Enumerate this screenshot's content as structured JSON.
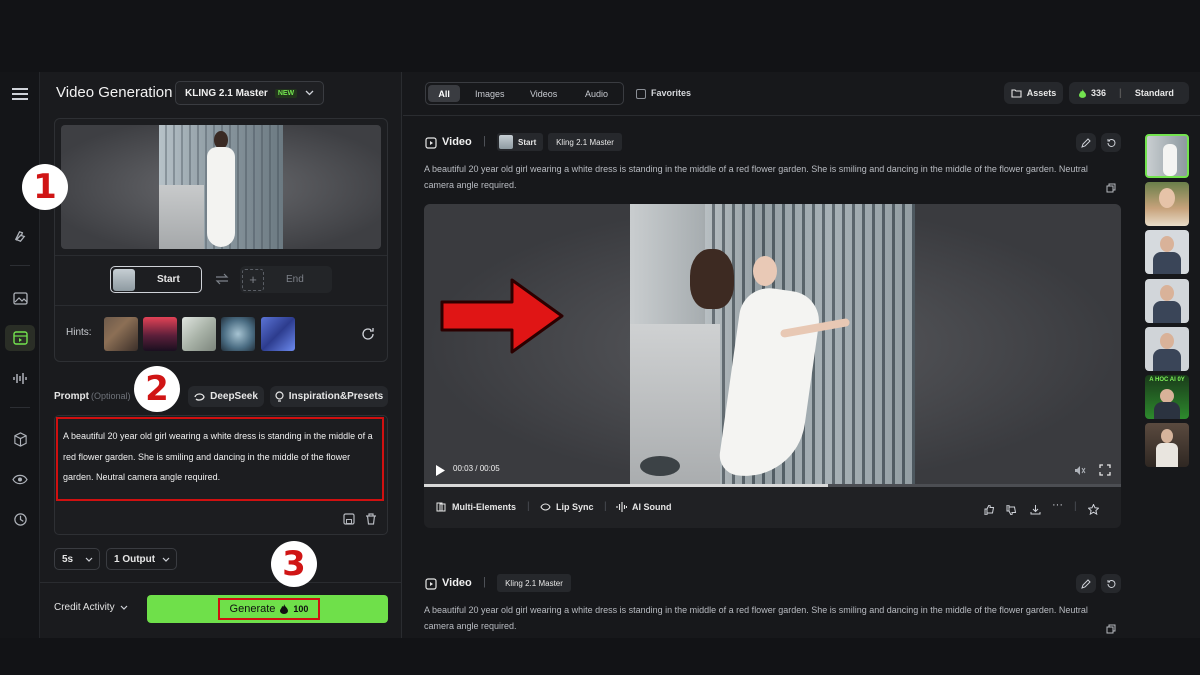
{
  "header": {
    "title": "Video Generation",
    "model": "KLING 2.1 Master",
    "model_badge": "NEW"
  },
  "frames": {
    "start_label": "Start",
    "end_label": "End"
  },
  "hints": {
    "label": "Hints:"
  },
  "prompt": {
    "label": "Prompt",
    "optional": "(Optional)",
    "deepseek": "DeepSeek",
    "presets": "Inspiration&Presets",
    "text": "A beautiful 20 year old girl wearing a white dress is standing in the middle of a red flower garden. She is smiling and dancing in the middle of the flower garden. Neutral camera angle required."
  },
  "options": {
    "duration": "5s",
    "outputs": "1 Output"
  },
  "footer": {
    "credit": "Credit Activity",
    "generate": "Generate",
    "cost": "100"
  },
  "filters": {
    "tabs": [
      "All",
      "Images",
      "Videos",
      "Audio"
    ],
    "favorites": "Favorites"
  },
  "topbar": {
    "assets": "Assets",
    "credits": "336",
    "plan": "Standard"
  },
  "card1": {
    "type": "Video",
    "start": "Start",
    "model": "Kling 2.1 Master",
    "desc": "A beautiful 20 year old girl wearing a white dress is standing in the middle of a red flower garden. She is smiling and dancing in the middle of the flower garden. Neutral camera angle required.",
    "time": "00:03 / 00:05",
    "progress": 0.58,
    "actions": [
      "Multi-Elements",
      "Lip Sync",
      "AI Sound"
    ]
  },
  "card2": {
    "type": "Video",
    "model": "Kling 2.1 Master",
    "desc": "A beautiful 20 year old girl wearing a white dress is standing in the middle of a red flower garden. She is smiling and dancing in the middle of the flower garden. Neutral camera angle required."
  },
  "annotations": {
    "one": "1",
    "two": "2",
    "three": "3"
  },
  "history_thumb_text": "A HOC AI 0Y",
  "colors": {
    "accent": "#73e34f",
    "annotation_red": "#d01010"
  }
}
